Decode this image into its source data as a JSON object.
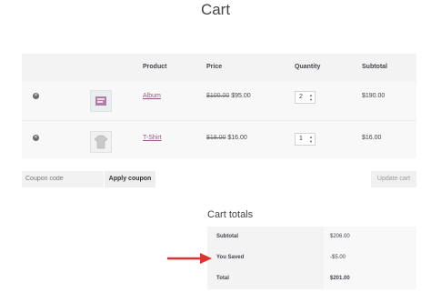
{
  "page": {
    "title": "Cart"
  },
  "cart": {
    "headers": {
      "product": "Product",
      "price": "Price",
      "quantity": "Quantity",
      "subtotal": "Subtotal"
    },
    "items": [
      {
        "name": "Album",
        "old_price": "$100.00",
        "price": "$95.00",
        "quantity": "2",
        "subtotal": "$190.00",
        "icon": "album-thumbnail"
      },
      {
        "name": "T-Shirt",
        "old_price": "$18.00",
        "price": "$16.00",
        "quantity": "1",
        "subtotal": "$16.00",
        "icon": "tshirt-thumbnail"
      }
    ]
  },
  "coupon": {
    "placeholder": "Coupon code",
    "apply_label": "Apply coupon"
  },
  "update_label": "Update cart",
  "totals": {
    "title": "Cart totals",
    "rows": [
      {
        "label": "Subtotal",
        "value": "$206.00"
      },
      {
        "label": "You Saved",
        "value": "-$5.00"
      },
      {
        "label": "Total",
        "value": "$201.00"
      }
    ]
  },
  "colors": {
    "link": "#96588a",
    "arrow": "#e0322f",
    "panel": "#f8f8f8"
  }
}
